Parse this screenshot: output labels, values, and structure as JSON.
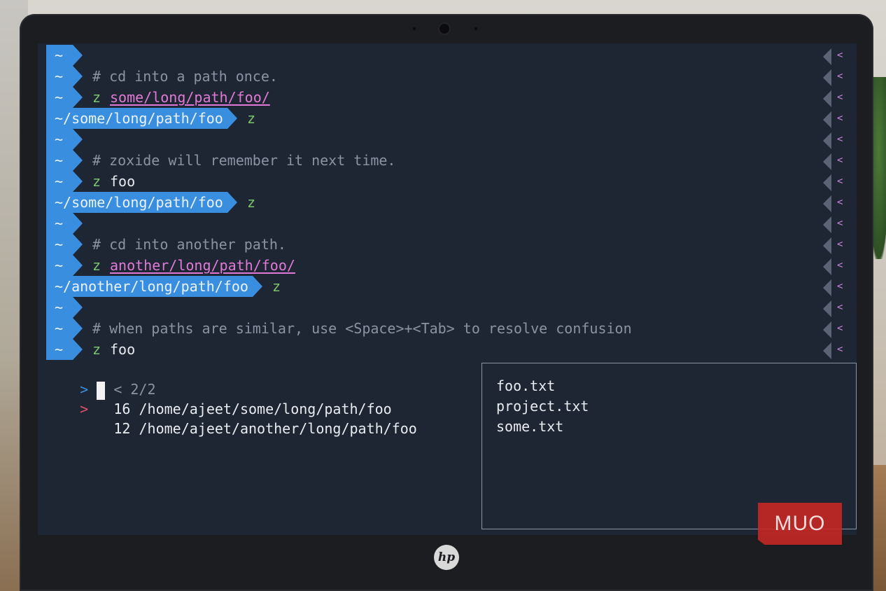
{
  "terminal": {
    "lines": [
      {
        "kind": "blank",
        "tilde": "~"
      },
      {
        "kind": "comment",
        "tilde": "~",
        "text": "# cd into a path once."
      },
      {
        "kind": "command",
        "tilde": "~",
        "cmd": "z",
        "arg": "some/long/path/foo/",
        "arg_style": "pink"
      },
      {
        "kind": "prompt",
        "path": "~/some/long/path/foo",
        "cmd": "z"
      },
      {
        "kind": "blank",
        "tilde": "~"
      },
      {
        "kind": "comment",
        "tilde": "~",
        "text": "# zoxide will remember it next time."
      },
      {
        "kind": "command",
        "tilde": "~",
        "cmd": "z",
        "arg": "foo",
        "arg_style": "white"
      },
      {
        "kind": "prompt",
        "path": "~/some/long/path/foo",
        "cmd": "z"
      },
      {
        "kind": "blank",
        "tilde": "~"
      },
      {
        "kind": "comment",
        "tilde": "~",
        "text": "# cd into another path."
      },
      {
        "kind": "command",
        "tilde": "~",
        "cmd": "z",
        "arg": "another/long/path/foo/",
        "arg_style": "pink"
      },
      {
        "kind": "prompt",
        "path": "~/another/long/path/foo",
        "cmd": "z"
      },
      {
        "kind": "blank",
        "tilde": "~"
      },
      {
        "kind": "comment",
        "tilde": "~",
        "text": "# when paths are similar, use <Space>+<Tab> to resolve confusion"
      },
      {
        "kind": "command",
        "tilde": "~",
        "cmd": "z",
        "arg": "foo",
        "arg_style": "white"
      }
    ],
    "right_prompt_glyph": "<",
    "fzf": {
      "prompt": ">",
      "counter": "< 2/2",
      "pointer": ">",
      "results": [
        {
          "score": "16",
          "path": "/home/ajeet/some/long/path/foo"
        },
        {
          "score": "12",
          "path": "/home/ajeet/another/long/path/foo"
        }
      ]
    },
    "preview_files": [
      "foo.txt",
      "project.txt",
      "some.txt"
    ]
  },
  "laptop": {
    "brand": "hp"
  },
  "watermark": "MUO",
  "colors": {
    "background": "#1f2633",
    "segment": "#3a8ee0",
    "comment": "#8b93a2",
    "command": "#7dc46f",
    "path_arg": "#e07ad6",
    "pointer": "#e0506a"
  }
}
